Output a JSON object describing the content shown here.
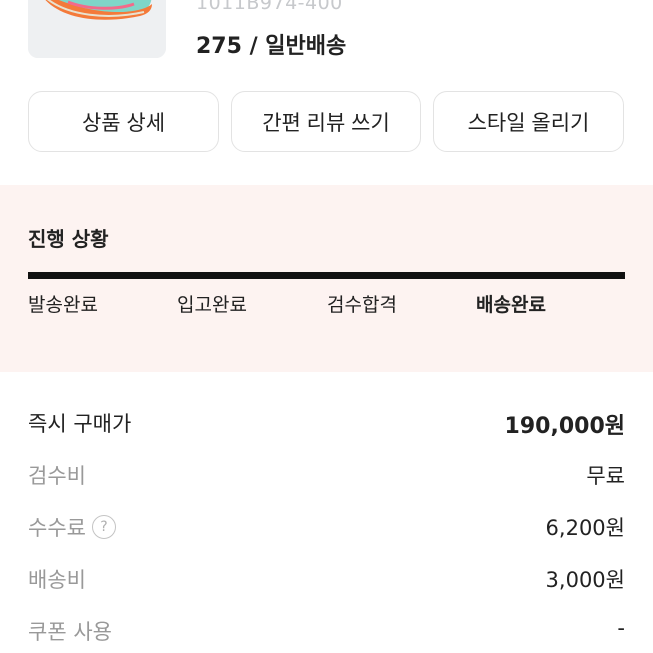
{
  "product": {
    "model_code": "1011B974-400",
    "option": "275 / 일반배송",
    "image_icon": "sneaker-image"
  },
  "actions": {
    "detail": "상품 상세",
    "review": "간편 리뷰 쓰기",
    "style": "스타일 올리기"
  },
  "progress": {
    "title": "진행 상황",
    "steps": [
      "발송완료",
      "입고완료",
      "검수합격",
      "배송완료"
    ],
    "current_step_index": 3,
    "completion": 1.0
  },
  "payment": {
    "rows": [
      {
        "label": "즉시 구매가",
        "value": "190,000원"
      },
      {
        "label": "검수비",
        "value": "무료"
      },
      {
        "label": "수수료",
        "value": "6,200원",
        "help_icon": "question-circle-icon"
      },
      {
        "label": "배송비",
        "value": "3,000원"
      },
      {
        "label": "쿠폰 사용",
        "value": "-"
      }
    ],
    "help_glyph": "?"
  },
  "colors": {
    "progress_bg": "#fdf3f1",
    "bar": "#111111",
    "muted_text": "#999999"
  }
}
